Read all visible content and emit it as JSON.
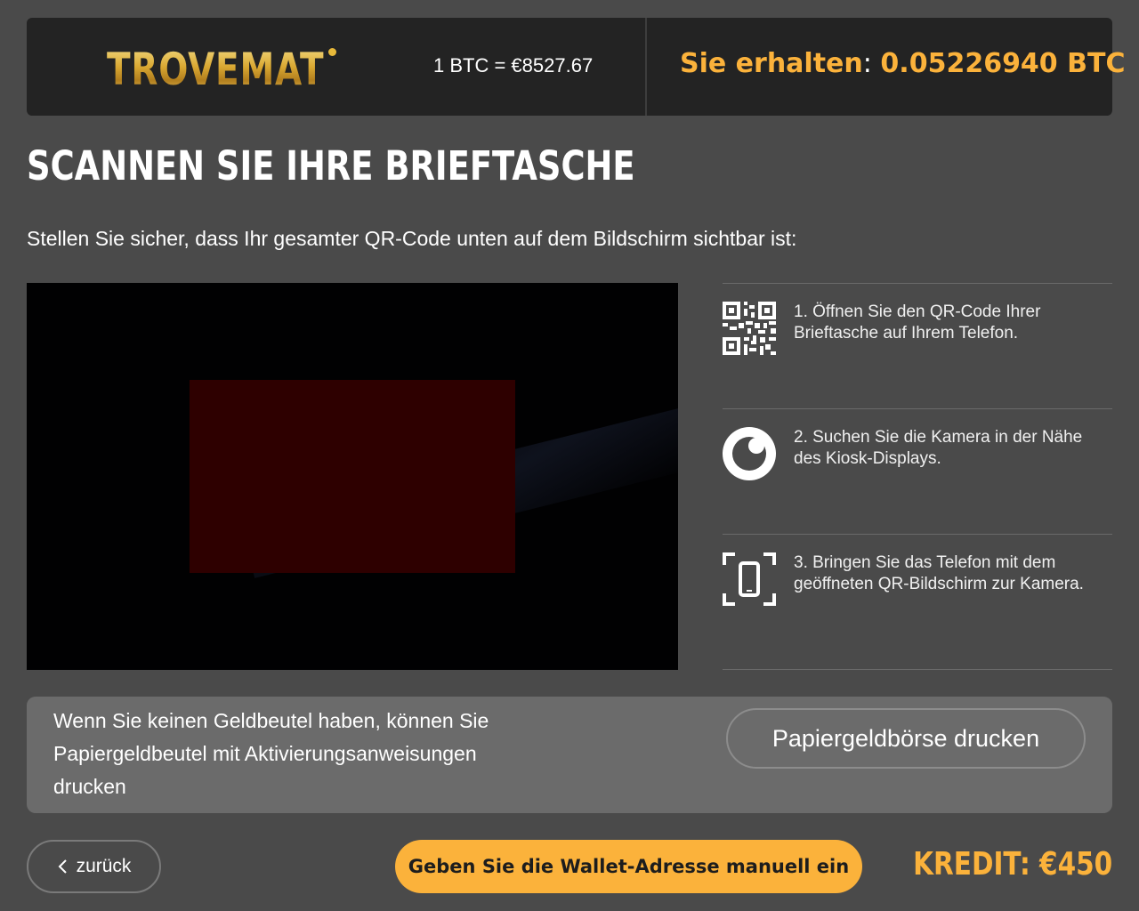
{
  "header": {
    "logo_text": "TROVEMAT",
    "rate": "1 BTC = €8527.67",
    "receive_label": "Sie erhalten",
    "receive_sep": ": ",
    "receive_value": "0.05226940 BTC"
  },
  "main": {
    "title": "SCANNEN SIE IHRE BRIEFTASCHE",
    "subtitle": "Stellen Sie sicher, dass Ihr gesamter QR-Code unten auf dem Bildschirm sichtbar ist:"
  },
  "steps": [
    {
      "icon": "qr-code-icon",
      "text": "1. Öffnen Sie den QR-Code Ihrer Brieftasche auf Ihrem Telefon."
    },
    {
      "icon": "camera-eye-icon",
      "text": "2. Suchen Sie die Kamera in der Nähe des Kiosk-Displays."
    },
    {
      "icon": "phone-scan-icon",
      "text": "3. Bringen Sie das Telefon mit dem geöffneten QR-Bildschirm zur Kamera."
    }
  ],
  "paper_wallet": {
    "text": "Wenn Sie keinen Geldbeutel haben, können Sie Papiergeldbeutel mit Aktivierungsanweisungen drucken",
    "button_label": "Papiergeldbörse drucken"
  },
  "footer": {
    "back_label": "zurück",
    "manual_label": "Geben Sie die Wallet-Adresse manuell ein",
    "credit": "KREDIT: €450"
  },
  "colors": {
    "accent": "#fbb23b",
    "background": "#4a4a4a",
    "header_bg": "#232323",
    "panel_bg": "#6b6b6b"
  }
}
